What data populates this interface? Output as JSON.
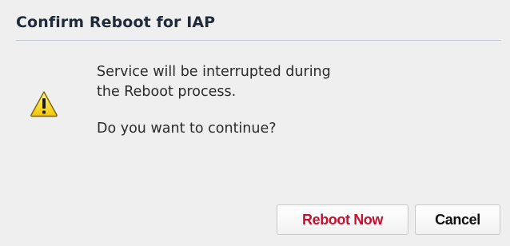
{
  "dialog": {
    "title": "Confirm Reboot for IAP",
    "icon": "warning-icon",
    "message_line1": "Service will be interrupted during",
    "message_line2": "the Reboot process.",
    "question": "Do you want to continue?",
    "reboot_label": "Reboot Now",
    "cancel_label": "Cancel",
    "colors": {
      "reboot_text": "#c8102e",
      "warning_fill": "#f5d400"
    }
  }
}
